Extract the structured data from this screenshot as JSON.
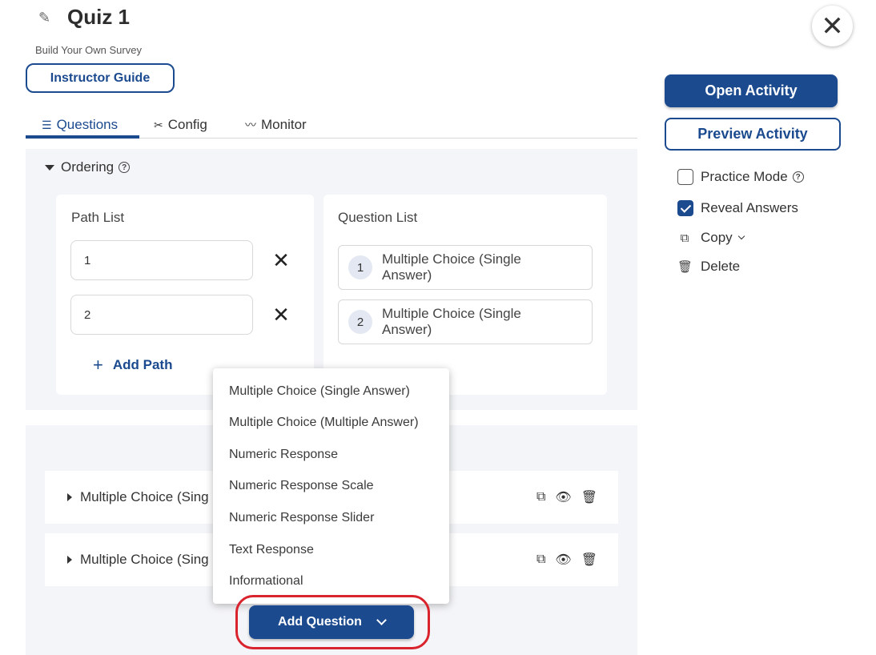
{
  "header": {
    "title": "Quiz 1",
    "subtitle": "Build Your Own Survey",
    "instructor_guide_label": "Instructor Guide",
    "edit_icon": "pencil-icon",
    "close_icon": "close-icon"
  },
  "tabs": [
    {
      "label": "Questions",
      "icon": "list-icon",
      "active": true
    },
    {
      "label": "Config",
      "icon": "tools-icon",
      "active": false
    },
    {
      "label": "Monitor",
      "icon": "pulse-icon",
      "active": false
    }
  ],
  "ordering": {
    "heading": "Ordering",
    "path_list": {
      "heading": "Path List",
      "paths": [
        "1",
        "2"
      ],
      "add_label": "Add Path"
    },
    "question_list": {
      "heading": "Question List",
      "items": [
        {
          "number": "1",
          "label": "Multiple Choice (Single Answer)"
        },
        {
          "number": "2",
          "label": "Multiple Choice (Single Answer)"
        }
      ]
    }
  },
  "question_rows": [
    {
      "label": "Multiple Choice (Sing"
    },
    {
      "label": "Multiple Choice (Sing"
    }
  ],
  "add_question_menu": {
    "items": [
      "Multiple Choice (Single Answer)",
      "Multiple Choice (Multiple Answer)",
      "Numeric Response",
      "Numeric Response Scale",
      "Numeric Response Slider",
      "Text Response",
      "Informational"
    ],
    "button_label": "Add Question"
  },
  "sidebar": {
    "open_activity_label": "Open Activity",
    "preview_activity_label": "Preview Activity",
    "practice_mode_label": "Practice Mode",
    "practice_mode_checked": false,
    "reveal_answers_label": "Reveal Answers",
    "reveal_answers_checked": true,
    "copy_label": "Copy",
    "delete_label": "Delete"
  },
  "colors": {
    "primary": "#1b4a8f",
    "highlight": "#d9232d",
    "panel_bg": "#f4f5f8"
  }
}
